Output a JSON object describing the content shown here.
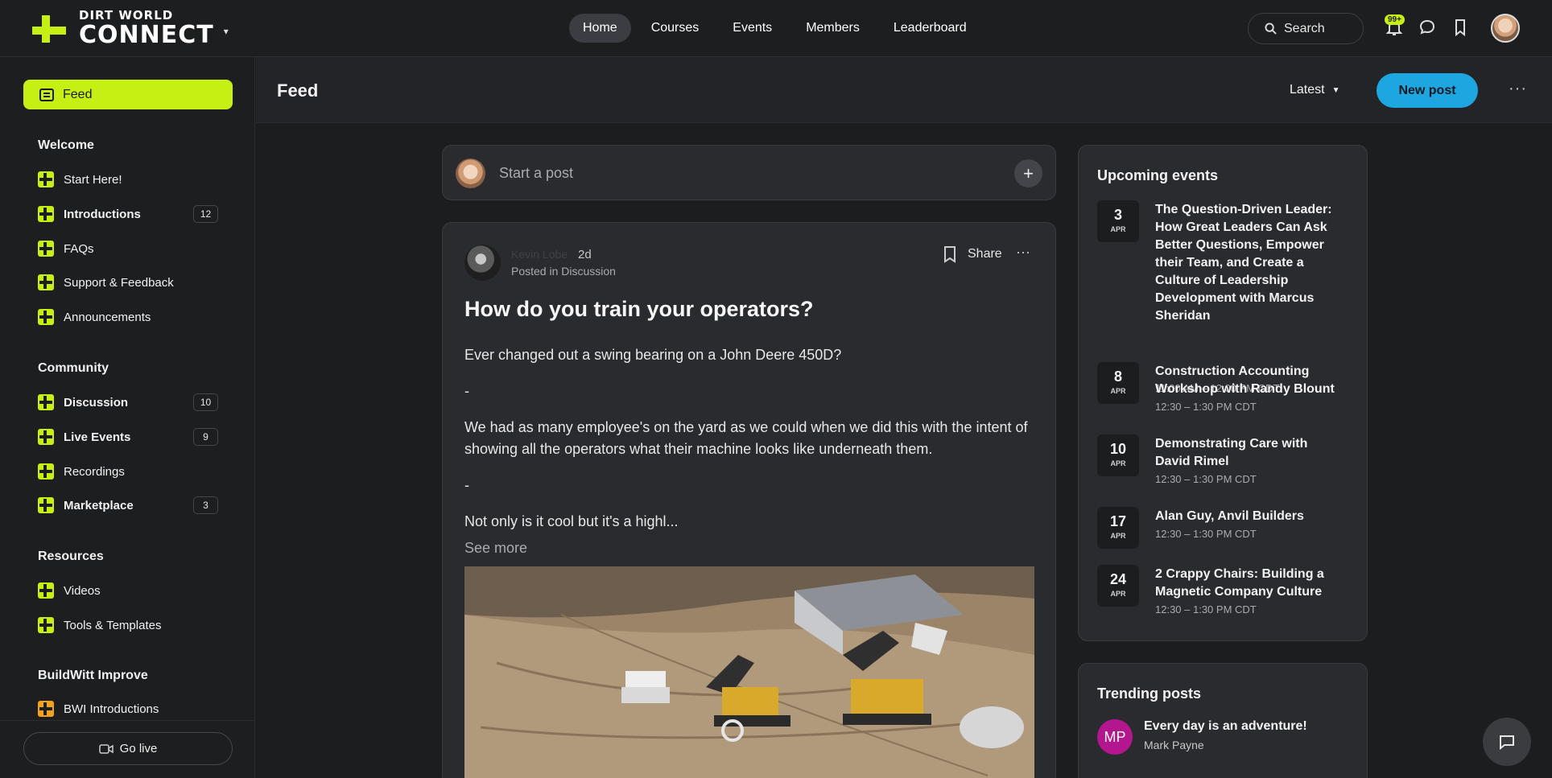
{
  "brand": {
    "line1": "DIRT WORLD",
    "line2": "CONNECT"
  },
  "nav": [
    {
      "label": "Home",
      "active": true
    },
    {
      "label": "Courses",
      "active": false
    },
    {
      "label": "Events",
      "active": false
    },
    {
      "label": "Members",
      "active": false
    },
    {
      "label": "Leaderboard",
      "active": false
    }
  ],
  "search": {
    "placeholder": "Search"
  },
  "notifications": {
    "badge": "99+"
  },
  "colors": {
    "accent": "#c6f014",
    "primary_button": "#1ea6e0",
    "orange_icon": "#f3a21b"
  },
  "sidebar": {
    "feed_label": "Feed",
    "sections": [
      {
        "title": "Welcome",
        "items": [
          {
            "label": "Start Here!",
            "count": ""
          },
          {
            "label": "Introductions",
            "count": "12"
          },
          {
            "label": "FAQs",
            "count": ""
          },
          {
            "label": "Support & Feedback",
            "count": ""
          },
          {
            "label": "Announcements",
            "count": ""
          }
        ]
      },
      {
        "title": "Community",
        "items": [
          {
            "label": "Discussion",
            "count": "10"
          },
          {
            "label": "Live Events",
            "count": "9"
          },
          {
            "label": "Recordings",
            "count": ""
          },
          {
            "label": "Marketplace",
            "count": "3"
          }
        ]
      },
      {
        "title": "Resources",
        "items": [
          {
            "label": "Videos",
            "count": ""
          },
          {
            "label": "Tools & Templates",
            "count": ""
          }
        ]
      },
      {
        "title": "BuildWitt Improve",
        "items": [
          {
            "label": "BWI Introductions",
            "count": ""
          }
        ]
      }
    ],
    "go_live": "Go live"
  },
  "header": {
    "title": "Feed",
    "sort": "Latest",
    "new_post": "New post"
  },
  "composer": {
    "placeholder": "Start a post"
  },
  "post": {
    "author": "Kevin Lobe",
    "time": "2d",
    "posted_in": "Posted in Discussion",
    "share": "Share",
    "title": "How do you train your operators?",
    "paragraphs": [
      "Ever changed out a swing bearing on a John Deere 450D?",
      "-",
      "We had as many employee's on the yard as we could when we did this with the intent of showing all the operators what their machine looks like underneath them.",
      "-",
      "Not only is it cool but it's a highl..."
    ],
    "see_more": "See more"
  },
  "events": {
    "title": "Upcoming events",
    "items": [
      {
        "day": "3",
        "month": "APR",
        "title": "The Question-Driven Leader: How Great Leaders Can Ask Better Questions, Empower their Team, and Create a Culture of Leadership Development with Marcus Sheridan",
        "time": "11:00 AM – 12:00 PM CDT"
      },
      {
        "day": "8",
        "month": "APR",
        "title": "Construction Accounting Workshop with Randy Blount",
        "time": "12:30 – 1:30 PM CDT"
      },
      {
        "day": "10",
        "month": "APR",
        "title": "Demonstrating Care with David Rimel",
        "time": "12:30 – 1:30 PM CDT"
      },
      {
        "day": "17",
        "month": "APR",
        "title": "Alan Guy, Anvil Builders",
        "time": "12:30 – 1:30 PM CDT"
      },
      {
        "day": "24",
        "month": "APR",
        "title": "2 Crappy Chairs: Building a Magnetic Company Culture",
        "time": "12:30 – 1:30 PM CDT"
      }
    ]
  },
  "trending": {
    "title": "Trending posts",
    "items": [
      {
        "initials": "MP",
        "title": "Every day is an adventure!",
        "author": "Mark Payne"
      }
    ]
  }
}
